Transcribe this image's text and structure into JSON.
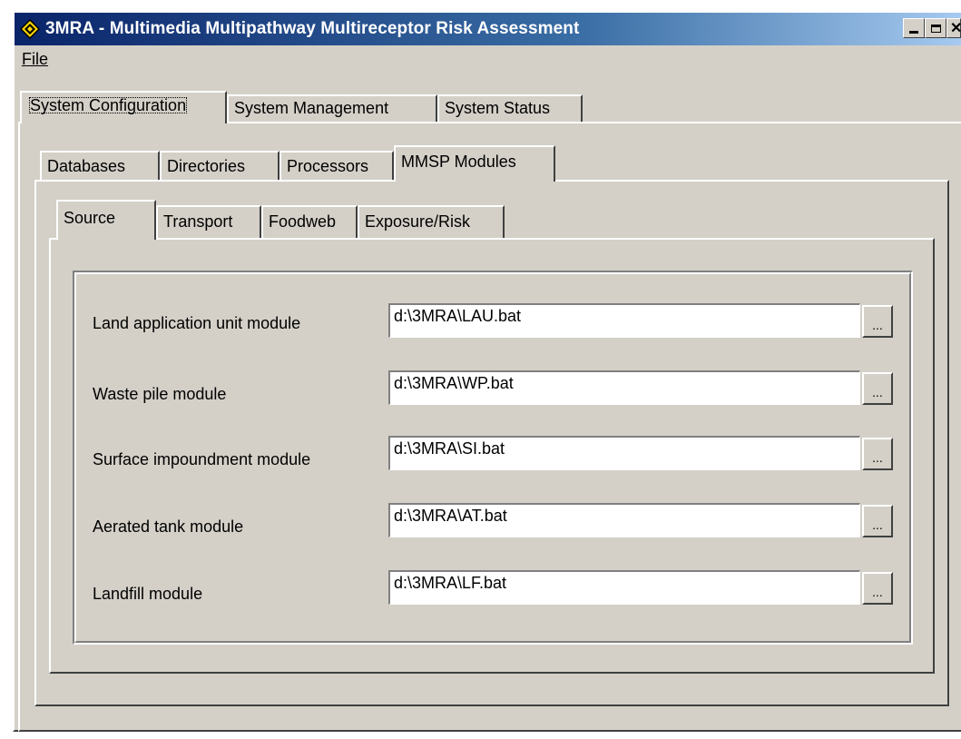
{
  "window": {
    "title": "3MRA - Multimedia Multipathway Multireceptor Risk Assessment",
    "icon": "diamond-warning-icon"
  },
  "menu": {
    "file": "File"
  },
  "main_tabs": [
    {
      "label": "System Configuration",
      "active": true
    },
    {
      "label": "System Management",
      "active": false
    },
    {
      "label": "System Status",
      "active": false
    }
  ],
  "config_tabs": [
    {
      "label": "Databases",
      "active": false
    },
    {
      "label": "Directories",
      "active": false
    },
    {
      "label": "Processors",
      "active": false
    },
    {
      "label": "MMSP Modules",
      "active": true
    }
  ],
  "module_tabs": [
    {
      "label": "Source",
      "active": true
    },
    {
      "label": "Transport",
      "active": false
    },
    {
      "label": "Foodweb",
      "active": false
    },
    {
      "label": "Exposure/Risk",
      "active": false
    }
  ],
  "modules": [
    {
      "label": "Land application unit module",
      "value": "d:\\3MRA\\LAU.bat",
      "browse": "..."
    },
    {
      "label": "Waste pile module",
      "value": "d:\\3MRA\\WP.bat",
      "browse": "..."
    },
    {
      "label": "Surface impoundment module",
      "value": "d:\\3MRA\\SI.bat",
      "browse": "..."
    },
    {
      "label": "Aerated tank module",
      "value": "d:\\3MRA\\AT.bat",
      "browse": "..."
    },
    {
      "label": "Landfill module",
      "value": "d:\\3MRA\\LF.bat",
      "browse": "..."
    }
  ],
  "colors": {
    "face": "#d4d0c8",
    "title_start": "#0a246a",
    "title_end": "#a6caf0"
  }
}
